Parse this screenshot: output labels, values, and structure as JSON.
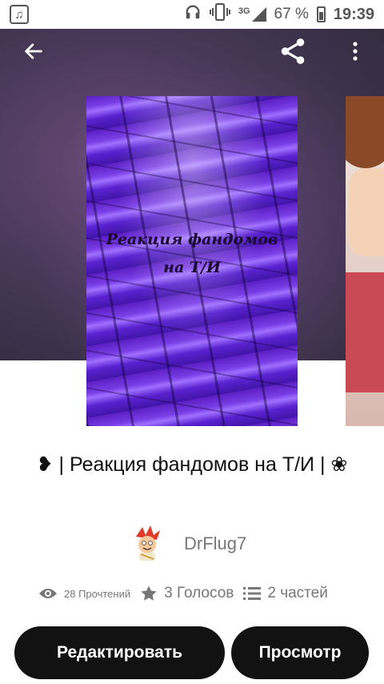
{
  "status_bar": {
    "network": "3G",
    "battery": "67 %",
    "time": "19:39",
    "icons": [
      "music-note-icon",
      "headphones-icon",
      "vibrate-icon",
      "signal-icon",
      "battery-icon"
    ]
  },
  "hero": {
    "cover_text_line1": "Реакция фандомов",
    "cover_text_line2": "на Т/И",
    "icons": [
      "back-arrow-icon",
      "share-icon",
      "more-vert-icon"
    ]
  },
  "story": {
    "title": "❥ | Реакция фандомов на Т/И | ❀",
    "author": "DrFlug7"
  },
  "stats": {
    "reads": "28 Прочтений",
    "votes": "3 Голосов",
    "parts": "2 частей"
  },
  "buttons": {
    "edit": "Редактировать",
    "view": "Просмотр"
  }
}
